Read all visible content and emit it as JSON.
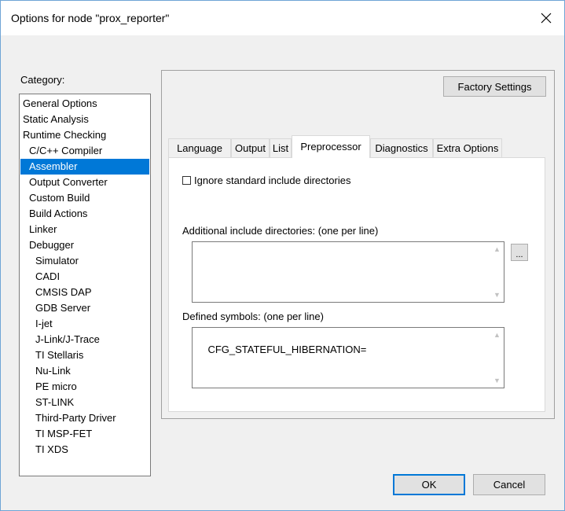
{
  "window": {
    "title": "Options for node \"prox_reporter\""
  },
  "category": {
    "label": "Category:",
    "items": [
      {
        "label": "General Options",
        "indent": 0,
        "selected": false
      },
      {
        "label": "Static Analysis",
        "indent": 0,
        "selected": false
      },
      {
        "label": "Runtime Checking",
        "indent": 0,
        "selected": false
      },
      {
        "label": "C/C++ Compiler",
        "indent": 1,
        "selected": false
      },
      {
        "label": "Assembler",
        "indent": 1,
        "selected": true
      },
      {
        "label": "Output Converter",
        "indent": 1,
        "selected": false
      },
      {
        "label": "Custom Build",
        "indent": 1,
        "selected": false
      },
      {
        "label": "Build Actions",
        "indent": 1,
        "selected": false
      },
      {
        "label": "Linker",
        "indent": 1,
        "selected": false
      },
      {
        "label": "Debugger",
        "indent": 1,
        "selected": false
      },
      {
        "label": "Simulator",
        "indent": 2,
        "selected": false
      },
      {
        "label": "CADI",
        "indent": 2,
        "selected": false
      },
      {
        "label": "CMSIS DAP",
        "indent": 2,
        "selected": false
      },
      {
        "label": "GDB Server",
        "indent": 2,
        "selected": false
      },
      {
        "label": "I-jet",
        "indent": 2,
        "selected": false
      },
      {
        "label": "J-Link/J-Trace",
        "indent": 2,
        "selected": false
      },
      {
        "label": "TI Stellaris",
        "indent": 2,
        "selected": false
      },
      {
        "label": "Nu-Link",
        "indent": 2,
        "selected": false
      },
      {
        "label": "PE micro",
        "indent": 2,
        "selected": false
      },
      {
        "label": "ST-LINK",
        "indent": 2,
        "selected": false
      },
      {
        "label": "Third-Party Driver",
        "indent": 2,
        "selected": false
      },
      {
        "label": "TI MSP-FET",
        "indent": 2,
        "selected": false
      },
      {
        "label": "TI XDS",
        "indent": 2,
        "selected": false
      }
    ]
  },
  "factory_settings_label": "Factory Settings",
  "tabs": [
    {
      "label": "Language",
      "active": false
    },
    {
      "label": "Output",
      "active": false
    },
    {
      "label": "List",
      "active": false
    },
    {
      "label": "Preprocessor",
      "active": true
    },
    {
      "label": "Diagnostics",
      "active": false
    },
    {
      "label": "Extra Options",
      "active": false
    }
  ],
  "preprocessor": {
    "ignore_std_include_label": "Ignore standard include directories",
    "ignore_std_include_checked": false,
    "additional_include_label": "Additional include directories:  (one per line)",
    "additional_include_value": "",
    "browse_label": "...",
    "defined_symbols_label": "Defined symbols:  (one per line)",
    "defined_symbols_value": "CFG_STATEFUL_HIBERNATION="
  },
  "buttons": {
    "ok": "OK",
    "cancel": "Cancel"
  }
}
